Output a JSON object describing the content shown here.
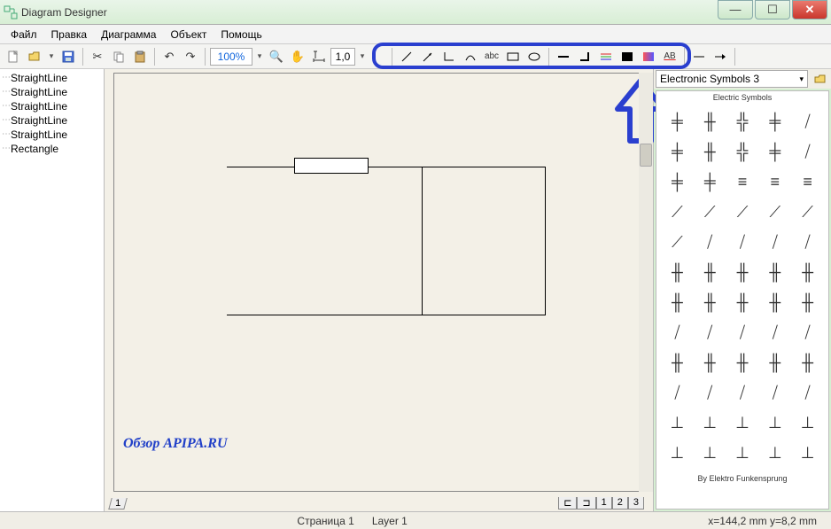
{
  "app": {
    "title": "Diagram Designer"
  },
  "menu": {
    "file": "Файл",
    "edit": "Правка",
    "diagram": "Диаграмма",
    "object": "Объект",
    "help": "Помощь"
  },
  "toolbar": {
    "zoom": "100%",
    "line_weight": "1,0"
  },
  "tree": {
    "items": [
      "StraightLine",
      "StraightLine",
      "StraightLine",
      "StraightLine",
      "StraightLine",
      "Rectangle"
    ]
  },
  "canvas": {
    "watermark": "Обзор APIPA.RU",
    "left_tab": "1",
    "right_tabs": [
      "1",
      "2",
      "3"
    ]
  },
  "palette": {
    "selected": "Electronic Symbols 3",
    "title": "Electric Symbols",
    "footer": "By Elektro Funkensprung"
  },
  "status": {
    "page": "Страница 1",
    "layer": "Layer 1",
    "coords": "x=144,2 mm  y=8,2 mm"
  }
}
